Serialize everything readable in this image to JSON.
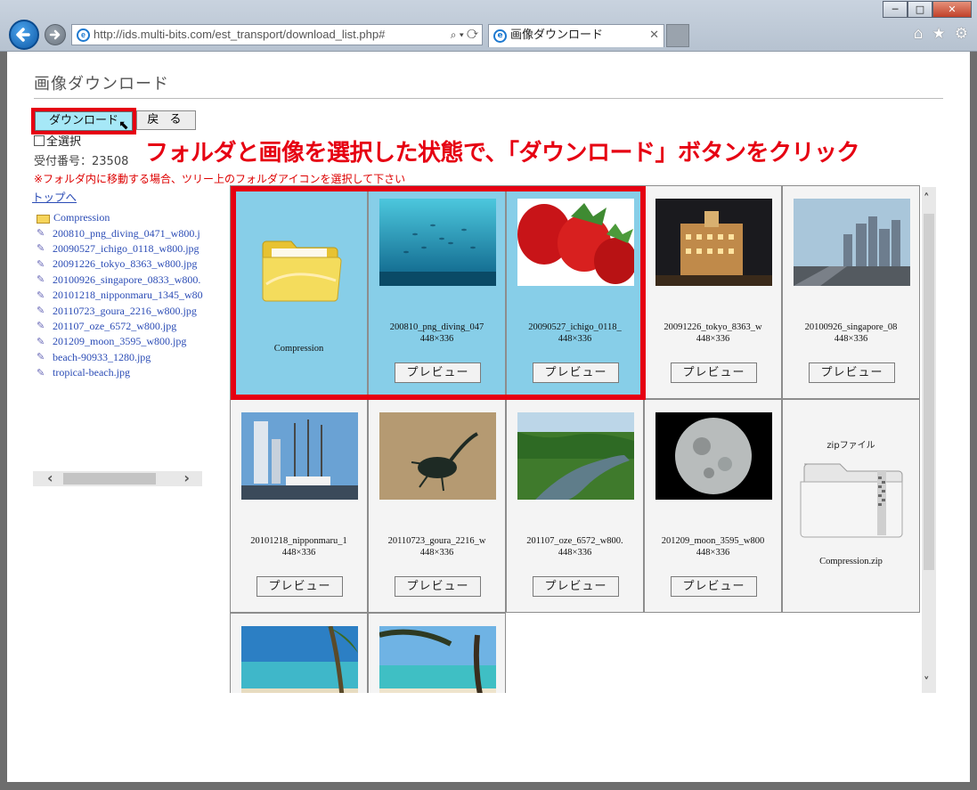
{
  "browser": {
    "url": "http://ids.multi-bits.com/est_transport/download_list.php#",
    "tab_title": "画像ダウンロード",
    "window_buttons": [
      "─",
      "□",
      "✕"
    ],
    "toolbar_icons": [
      "home-icon",
      "star-icon",
      "gear-icon"
    ]
  },
  "page": {
    "title": "画像ダウンロード",
    "download_button": "ダウンロード",
    "back_button": "戻 る",
    "select_all": "全選択",
    "receipt": "受付番号：23508",
    "warning": "※フォルダ内に移動する場合、ツリー上のフォルダアイコンを選択して下さい",
    "annotation": "フォルダと画像を選択した状態で、「ダウンロード」ボタンをクリック"
  },
  "tree": {
    "top_link": "トップへ",
    "items": [
      {
        "label": "Compression",
        "type": "folder"
      },
      {
        "label": "200810_png_diving_0471_w800.j",
        "type": "image"
      },
      {
        "label": "20090527_ichigo_0118_w800.jpg",
        "type": "image"
      },
      {
        "label": "20091226_tokyo_8363_w800.jpg",
        "type": "image"
      },
      {
        "label": "20100926_singapore_0833_w800.",
        "type": "image"
      },
      {
        "label": "20101218_nipponmaru_1345_w80",
        "type": "image"
      },
      {
        "label": "20110723_goura_2216_w800.jpg",
        "type": "image"
      },
      {
        "label": "201107_oze_6572_w800.jpg",
        "type": "image"
      },
      {
        "label": "201209_moon_3595_w800.jpg",
        "type": "image"
      },
      {
        "label": "beach-90933_1280.jpg",
        "type": "image"
      },
      {
        "label": "tropical-beach.jpg",
        "type": "image"
      }
    ]
  },
  "grid": {
    "preview_label": "プレビュー",
    "folder": {
      "name": "Compression"
    },
    "zip": {
      "label": "zipファイル",
      "name": "Compression.zip"
    },
    "images": [
      {
        "name": "200810_png_diving_047",
        "size": "448×336",
        "selected": true
      },
      {
        "name": "20090527_ichigo_0118_",
        "size": "448×336",
        "selected": true
      },
      {
        "name": "20091226_tokyo_8363_w",
        "size": "448×336",
        "selected": false
      },
      {
        "name": "20100926_singapore_08",
        "size": "448×336",
        "selected": false
      },
      {
        "name": "20101218_nipponmaru_1",
        "size": "448×336",
        "selected": false
      },
      {
        "name": "20110723_goura_2216_w",
        "size": "448×336",
        "selected": false
      },
      {
        "name": "201107_oze_6572_w800.",
        "size": "448×336",
        "selected": false
      },
      {
        "name": "201209_moon_3595_w800",
        "size": "448×336",
        "selected": false
      }
    ]
  }
}
